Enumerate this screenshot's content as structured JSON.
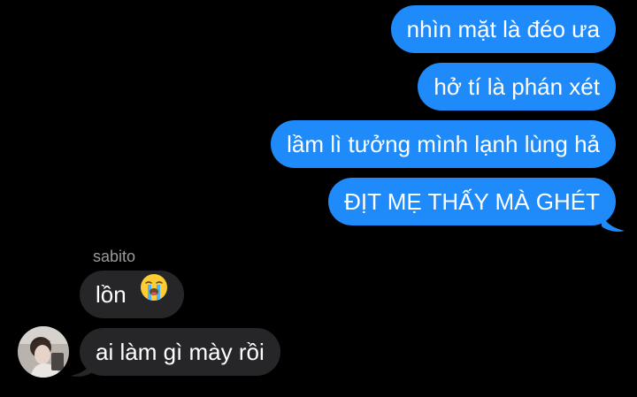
{
  "conversation": {
    "sent_messages": [
      "nhìn mặt là đéo ưa",
      "hở tí là phán xét",
      "lầm lì tưởng mình lạnh lùng hả",
      "ĐỊT MẸ THẤY MÀ GHÉT"
    ],
    "sender_name": "sabito",
    "received_messages": [
      {
        "text": "lồn",
        "emoji": "loudly-crying-face-icon"
      },
      {
        "text": "ai làm gì mày rồi"
      }
    ]
  },
  "colors": {
    "background": "#000000",
    "sent_bubble": "#1f8bfa",
    "received_bubble": "#262629",
    "sender_name": "#9a9a9f",
    "text": "#ffffff"
  }
}
